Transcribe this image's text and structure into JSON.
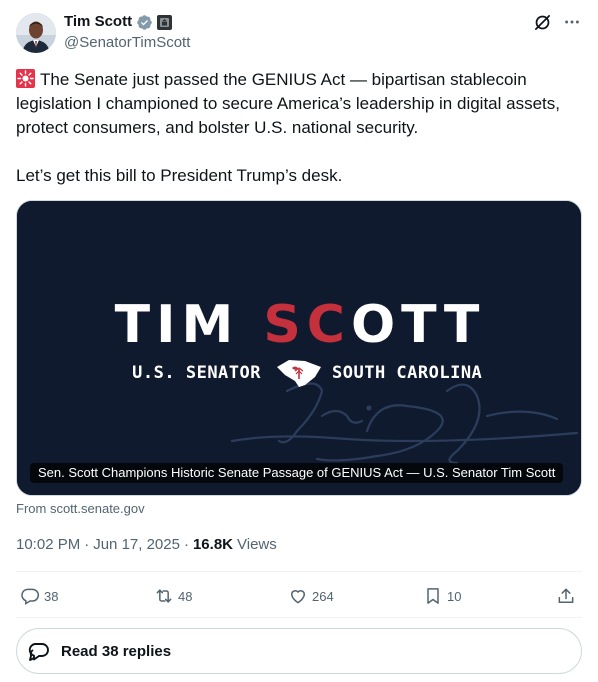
{
  "author": {
    "display_name": "Tim Scott",
    "handle": "@SenatorTimScott",
    "verified_icon": "verified-badge-icon",
    "affiliation_icon": "government-badge-icon"
  },
  "top_actions": {
    "grok_icon": "grok-icon",
    "more_icon": "more-icon"
  },
  "tweet": {
    "siren_icon": "police-light-emoji",
    "text": "The Senate just passed the GENIUS Act — bipartisan stablecoin legislation I championed to secure America’s leadership in digital assets, protect consumers, and bolster U.S. national security.\n\nLet’s get this bill to President Trump’s desk."
  },
  "card": {
    "brand_part1": "TIM ",
    "brand_part2": "SC",
    "brand_part3": "OTT",
    "sub_left": "U.S. SENATOR",
    "sub_right": "SOUTH CAROLINA",
    "caption": "Sen. Scott Champions Historic Senate Passage of GENIUS Act — U.S. Senator Tim Scott",
    "source": "From scott.senate.gov"
  },
  "meta": {
    "time": "10:02 PM",
    "date": "Jun 17, 2025",
    "views_count": "16.8K",
    "views_label": "Views"
  },
  "actions": {
    "replies": "38",
    "reposts": "48",
    "likes": "264",
    "bookmarks": "10"
  },
  "read_replies": "Read 38 replies",
  "colors": {
    "accent_red": "#c5303d",
    "card_bg": "#101a2e",
    "muted": "#536471"
  }
}
